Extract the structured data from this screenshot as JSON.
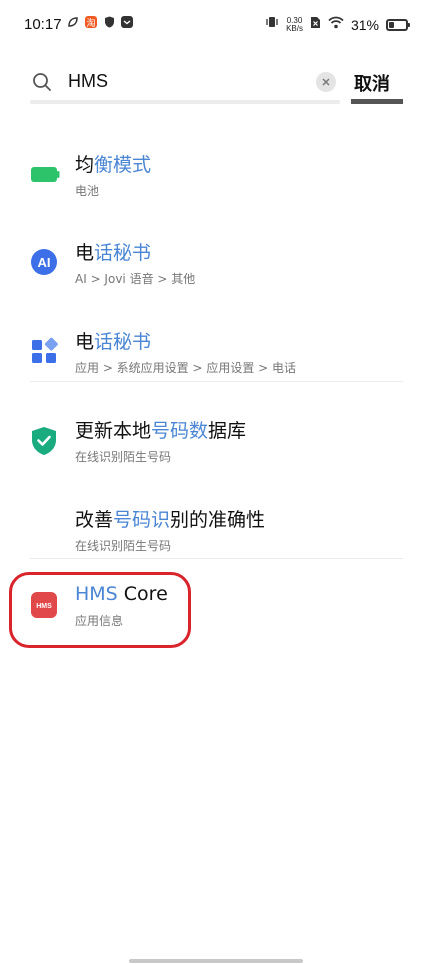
{
  "status_bar": {
    "time": "10:17",
    "speed_value": "0.30",
    "speed_unit": "KB/s",
    "battery_text": "31%",
    "battery_level": 0.31
  },
  "search": {
    "query": "HMS",
    "cancel_label": "取消"
  },
  "results": [
    {
      "title_plain": "均",
      "title_hl": "衡模式",
      "title_rest": "",
      "subtitle": "电池",
      "icon": "battery-icon"
    },
    {
      "title_plain": "电",
      "title_hl": "话秘书",
      "title_rest": "",
      "subtitle": "AI > Jovi 语音 > 其他",
      "icon": "ai-icon"
    },
    {
      "title_plain": "电",
      "title_hl": "话秘书",
      "title_rest": "",
      "subtitle": "应用 > 系统应用设置 > 应用设置 > 电话",
      "icon": "apps-grid-icon"
    },
    {
      "title_plain": "更新本地",
      "title_hl": "号码数",
      "title_rest": "据库",
      "subtitle": "在线识别陌生号码",
      "icon": "shield-check-icon"
    },
    {
      "title_plain": "改善",
      "title_hl": "号码识",
      "title_rest": "别的准确性",
      "subtitle": "在线识别陌生号码",
      "icon": ""
    },
    {
      "title_plain": "",
      "title_hl": "HMS",
      "title_rest": " Core",
      "subtitle": "应用信息",
      "icon": "hms-core-icon",
      "icon_text": "HMS"
    }
  ],
  "colors": {
    "highlight": "#4a86d4",
    "selection_box": "#d9242b"
  }
}
